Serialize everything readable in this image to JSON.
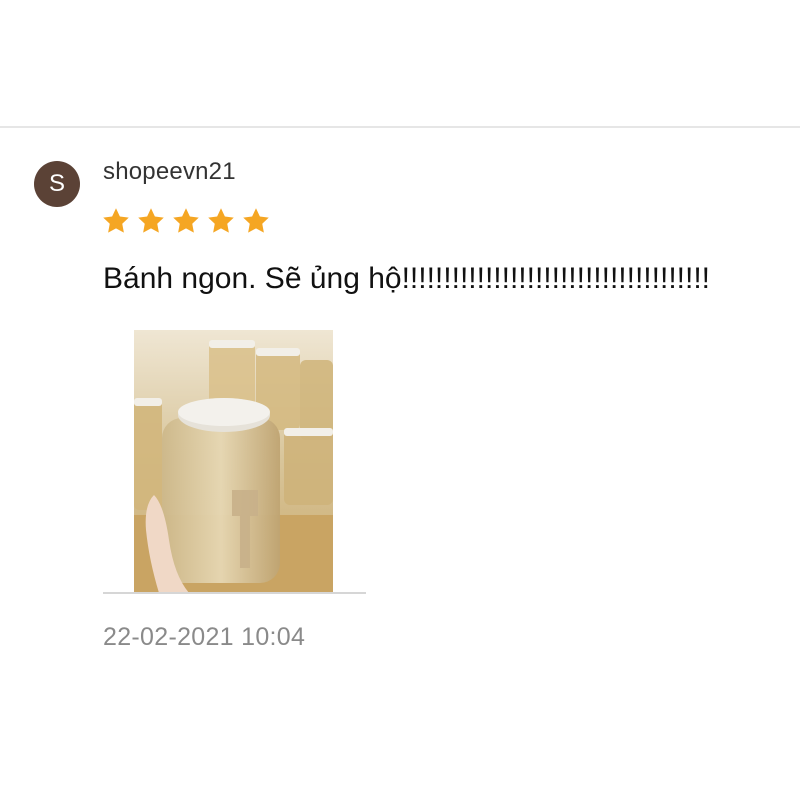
{
  "review": {
    "avatar_letter": "S",
    "avatar_color": "#5b4236",
    "username": "shopeevn21",
    "rating": 5,
    "rating_max": 5,
    "star_color": "#f5a623",
    "text": "Bánh ngon. Sẽ ủng hộ!!!!!!!!!!!!!!!!!!!!!!!!!!!!!!!!!!!!!",
    "timestamp": "22-02-2021 10:04"
  }
}
